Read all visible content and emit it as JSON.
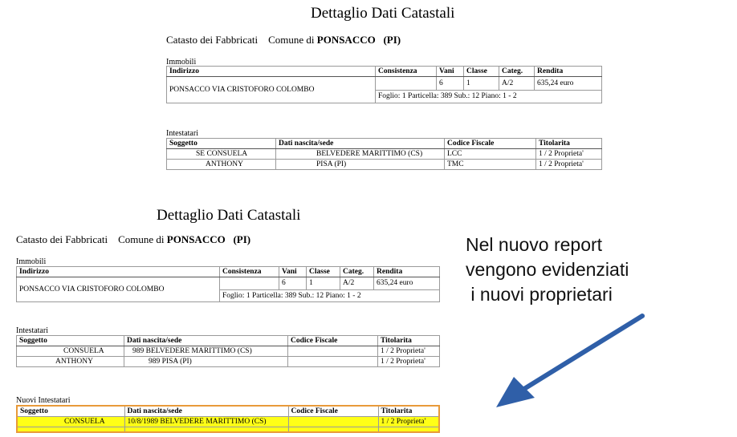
{
  "top": {
    "title": "Dettaglio Dati Catastali",
    "catasto_label": "Catasto dei Fabbricati",
    "comune_label": "Comune di",
    "comune_name": "PONSACCO",
    "provincia": "(PI)",
    "immobili_label": "Immobili",
    "immobili_headers": [
      "Indirizzo",
      "Consistenza",
      "Vani",
      "Classe",
      "Categ.",
      "Rendita"
    ],
    "immobile": {
      "indirizzo": "PONSACCO VIA CRISTOFORO COLOMBO",
      "consistenza": "",
      "vani": "6",
      "classe": "1",
      "categ": "A/2",
      "rendita": "635,24  euro",
      "foglio": "Foglio: 1   Particella: 389   Sub.: 12   Piano:  1 - 2"
    },
    "intestatari_label": "Intestatari",
    "intestatari_headers": [
      "Soggetto",
      "Dati nascita/sede",
      "Codice Fiscale",
      "Titolarita"
    ],
    "intestatari": [
      {
        "soggetto": "SE  CONSUELA",
        "nascita": "BELVEDERE MARITTIMO (CS)",
        "cf": "LCC",
        "titolarita": "1 / 2   Proprieta'"
      },
      {
        "soggetto": "ANTHONY",
        "nascita": "PISA (PI)",
        "cf": "TMC",
        "titolarita": "1 / 2   Proprieta'"
      }
    ]
  },
  "bottom": {
    "title": "Dettaglio Dati Catastali",
    "catasto_label": "Catasto dei Fabbricati",
    "comune_label": "Comune di",
    "comune_name": "PONSACCO",
    "provincia": "(PI)",
    "immobili_label": "Immobili",
    "immobili_headers": [
      "Indirizzo",
      "Consistenza",
      "Vani",
      "Classe",
      "Categ.",
      "Rendita"
    ],
    "immobile": {
      "indirizzo": "PONSACCO VIA CRISTOFORO COLOMBO",
      "consistenza": "",
      "vani": "6",
      "classe": "1",
      "categ": "A/2",
      "rendita": "635,24  euro",
      "foglio": "Foglio: 1   Particella: 389   Sub.: 12   Piano:  1 - 2"
    },
    "intestatari_label": "Intestatari",
    "intestatari_headers": [
      "Soggetto",
      "Dati nascita/sede",
      "Codice Fiscale",
      "Titolarita"
    ],
    "intestatari": [
      {
        "soggetto": "CONSUELA",
        "nascita": "989  BELVEDERE MARITTIMO (CS)",
        "cf": "",
        "titolarita": "1 / 2   Proprieta'"
      },
      {
        "soggetto": "ANTHONY",
        "nascita": "989  PISA (PI)",
        "cf": "",
        "titolarita": "1 / 2   Proprieta'"
      }
    ],
    "nuovi_label": "Nuovi Intestatari",
    "nuovi_headers": [
      "Soggetto",
      "Dati nascita/sede",
      "Codice Fiscale",
      "Titolarita"
    ],
    "nuovi": [
      {
        "soggetto": "CONSUELA",
        "nascita": "10/8/1989  BELVEDERE MARITTIMO (CS)",
        "cf": "",
        "titolarita": "1 / 2   Proprieta'"
      }
    ]
  },
  "annotation": {
    "text": "Nel nuovo report\nvengono evidenziati\n i nuovi proprietari",
    "arrow_color": "#2f5fa8",
    "highlight_color": "#ffff17",
    "border_color": "#e89a3a"
  }
}
